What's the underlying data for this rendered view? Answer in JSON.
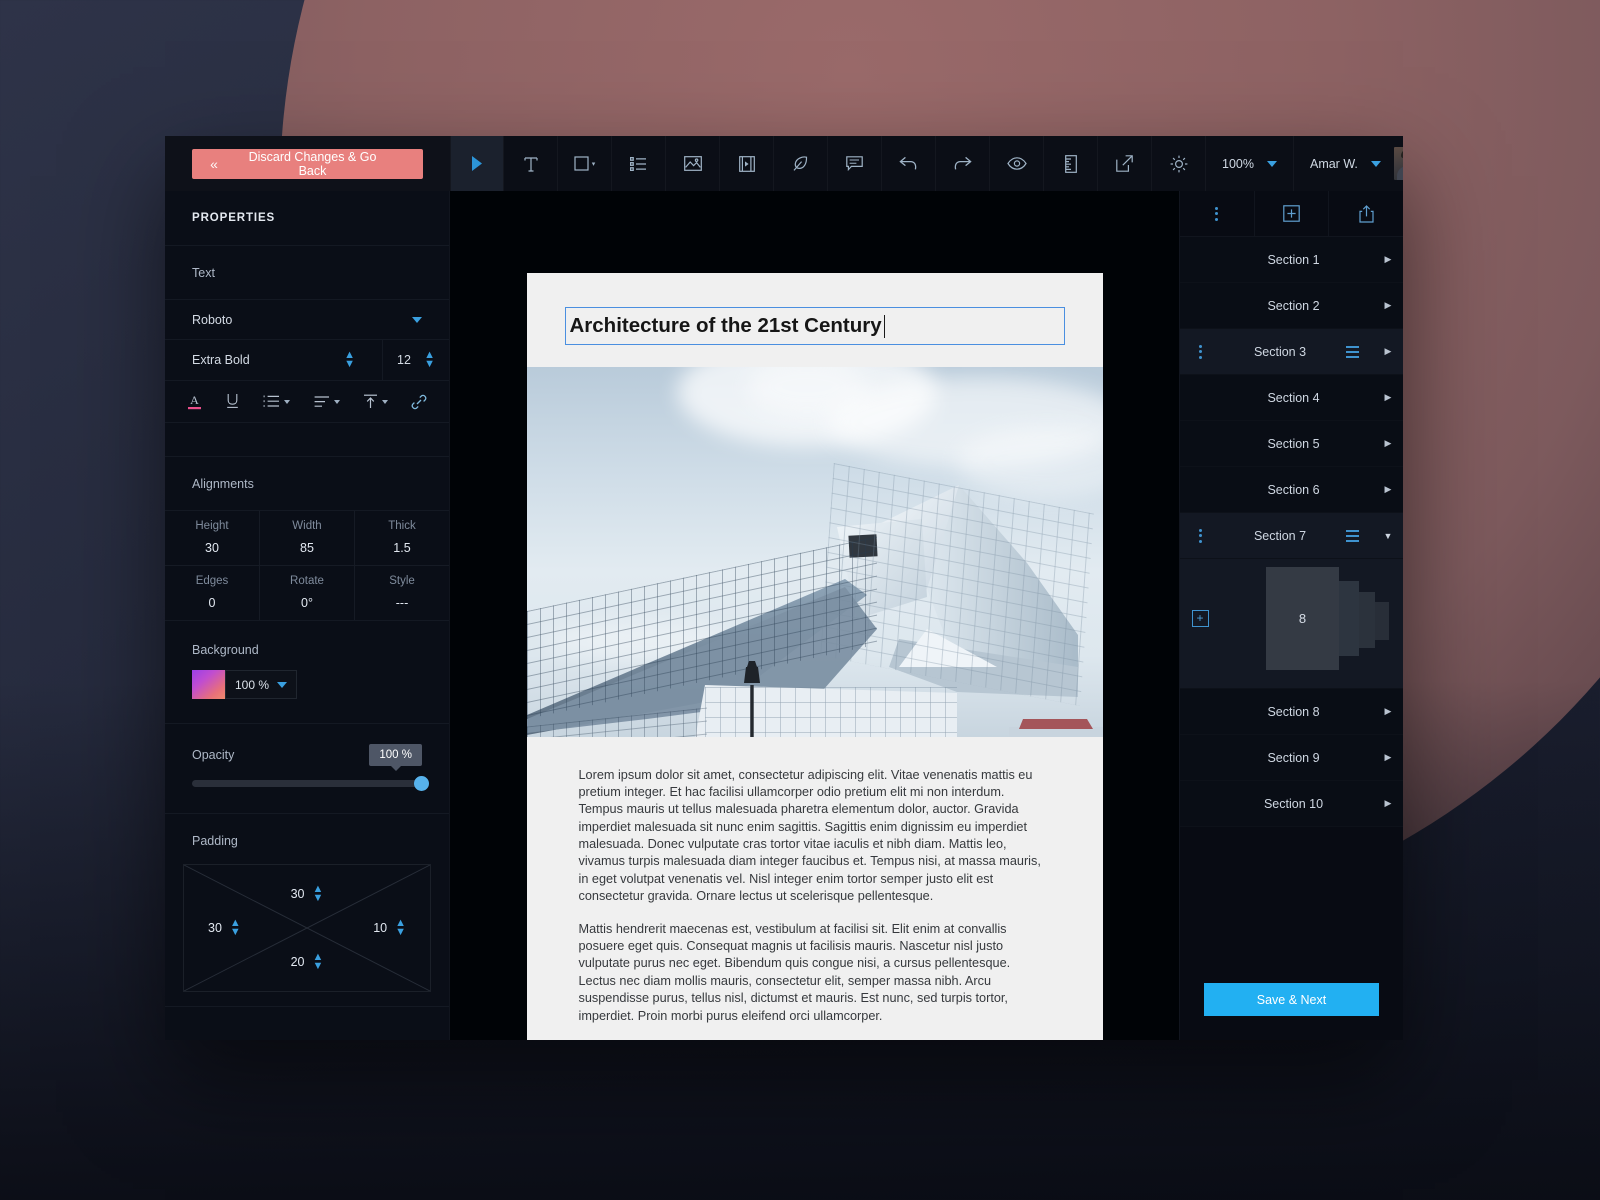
{
  "topbar": {
    "discard_label": "Discard Changes & Go Back",
    "discard_chevron": "«",
    "tools": [
      {
        "name": "select-pointer-tool",
        "icon": "pointer-icon",
        "active": true
      },
      {
        "name": "text-tool",
        "icon": "text-t-icon",
        "active": false
      },
      {
        "name": "shape-tool",
        "icon": "square-icon",
        "active": false,
        "caret": true
      },
      {
        "name": "list-tool",
        "icon": "bullet-list-icon",
        "active": false
      },
      {
        "name": "image-tool",
        "icon": "image-icon",
        "active": false
      },
      {
        "name": "video-tool",
        "icon": "film-icon",
        "active": false
      },
      {
        "name": "draw-tool",
        "icon": "feather-pen-icon",
        "active": false
      },
      {
        "name": "comment-tool",
        "icon": "comment-icon",
        "active": false
      },
      {
        "name": "undo-tool",
        "icon": "undo-arrow-icon",
        "active": false
      },
      {
        "name": "redo-tool",
        "icon": "redo-arrow-icon",
        "active": false
      },
      {
        "name": "preview-tool",
        "icon": "eye-icon",
        "active": false
      },
      {
        "name": "ruler-tool",
        "icon": "ruler-icon",
        "active": false
      },
      {
        "name": "export-tool",
        "icon": "external-link-icon",
        "active": false
      },
      {
        "name": "brightness-tool",
        "icon": "sun-icon",
        "active": false
      }
    ],
    "zoom_value": "100%",
    "user_name": "Amar W."
  },
  "properties": {
    "panel_title": "PROPERTIES",
    "text_group_label": "Text",
    "font_family": "Roboto",
    "font_weight": "Extra Bold",
    "font_size": "12",
    "format_icons": [
      {
        "name": "font-color-icon",
        "glyph": "A"
      },
      {
        "name": "underline-icon",
        "glyph": "U"
      },
      {
        "name": "bullet-list-icon",
        "glyph": "list"
      },
      {
        "name": "align-icon",
        "glyph": "align"
      },
      {
        "name": "vertical-align-top-icon",
        "glyph": "valign"
      },
      {
        "name": "link-icon",
        "glyph": "link"
      }
    ],
    "alignments_label": "Alignments",
    "alignments": [
      {
        "key": "Height",
        "value": "30"
      },
      {
        "key": "Width",
        "value": "85"
      },
      {
        "key": "Thick",
        "value": "1.5"
      },
      {
        "key": "Edges",
        "value": "0"
      },
      {
        "key": "Rotate",
        "value": "0°"
      },
      {
        "key": "Style",
        "value": "---"
      }
    ],
    "background_label": "Background",
    "background_color": "#b44ee0",
    "background_percent": "100 %",
    "opacity_label": "Opacity",
    "opacity_value": "100 %",
    "opacity_fill_percent": 100,
    "padding_label": "Padding",
    "padding": {
      "top": "30",
      "left": "30",
      "right": "10",
      "bottom": "20"
    }
  },
  "document": {
    "title": "Architecture of the 21st Century",
    "image_alt": "modern glass museum building photographed from below",
    "paragraphs": [
      "Lorem ipsum dolor sit amet, consectetur adipiscing elit. Vitae venenatis mattis eu pretium integer. Et hac facilisi ullamcorper odio pretium elit mi non interdum. Tempus mauris ut tellus malesuada pharetra elementum dolor, auctor. Gravida imperdiet malesuada sit nunc enim sagittis. Sagittis enim dignissim eu imperdiet malesuada. Donec vulputate cras tortor vitae iaculis et nibh diam. Mattis leo, vivamus turpis malesuada diam integer faucibus et. Tempus nisi, at massa mauris, in eget volutpat venenatis vel. Nisl integer enim tortor semper justo elit est consectetur gravida. Ornare lectus ut scelerisque pellentesque.",
      "Mattis hendrerit maecenas est, vestibulum at facilisi sit. Elit enim at convallis posuere eget quis. Consequat magnis ut facilisis mauris. Nascetur nisl justo vulputate purus nec eget. Bibendum quis congue nisi, a cursus pellentesque. Lectus nec diam mollis mauris, consectetur elit, semper massa nibh. Arcu suspendisse purus, tellus nisl, dictumst et mauris. Est nunc, sed turpis tortor, imperdiet. Proin morbi purus eleifend orci ullamcorper."
    ]
  },
  "sections": {
    "toolbar": [
      {
        "name": "section-options-button",
        "icon": "vertical-dots-icon"
      },
      {
        "name": "add-section-button",
        "icon": "plus-box-icon"
      },
      {
        "name": "share-section-button",
        "icon": "share-upload-icon"
      }
    ],
    "items": [
      {
        "label": "Section 1",
        "selected": false,
        "expanded": false
      },
      {
        "label": "Section 2",
        "selected": false,
        "expanded": false
      },
      {
        "label": "Section 3",
        "selected": true,
        "expanded": false
      },
      {
        "label": "Section 4",
        "selected": false,
        "expanded": false
      },
      {
        "label": "Section 5",
        "selected": false,
        "expanded": false
      },
      {
        "label": "Section 6",
        "selected": false,
        "expanded": false
      },
      {
        "label": "Section 7",
        "selected": true,
        "expanded": true
      },
      {
        "label": "Section 8",
        "selected": false,
        "expanded": false
      },
      {
        "label": "Section 9",
        "selected": false,
        "expanded": false
      },
      {
        "label": "Section 10",
        "selected": false,
        "expanded": false
      }
    ],
    "expanded_card_label": "8",
    "save_label": "Save & Next"
  }
}
